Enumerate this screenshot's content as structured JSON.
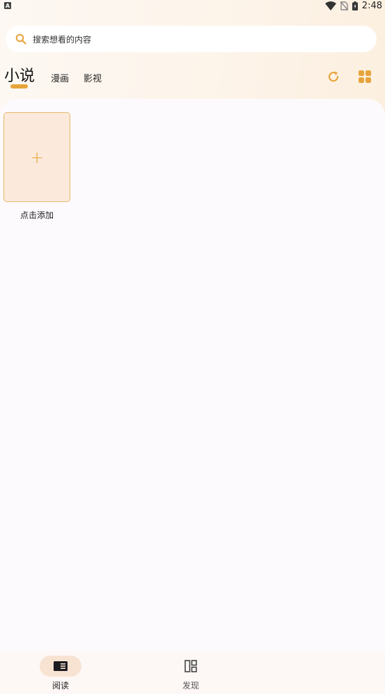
{
  "status_bar": {
    "app_badge": "A",
    "time": "2:48"
  },
  "search": {
    "placeholder": "搜索想看的内容"
  },
  "tabs": {
    "items": [
      {
        "label": "小说",
        "active": true
      },
      {
        "label": "漫画",
        "active": false
      },
      {
        "label": "影视",
        "active": false
      }
    ]
  },
  "toolbar": {
    "refresh_icon": "refresh-icon",
    "layout_icon": "grid-icon"
  },
  "shelf": {
    "add_card_symbol": "+",
    "add_label": "点击添加"
  },
  "bottom_nav": {
    "items": [
      {
        "label": "阅读",
        "icon": "book-icon",
        "active": true
      },
      {
        "label": "发现",
        "icon": "discover-icon",
        "active": false
      }
    ]
  },
  "colors": {
    "accent": "#e7a43b",
    "card_bg": "#fbeadb",
    "nav_pill": "#f8e3d3"
  }
}
